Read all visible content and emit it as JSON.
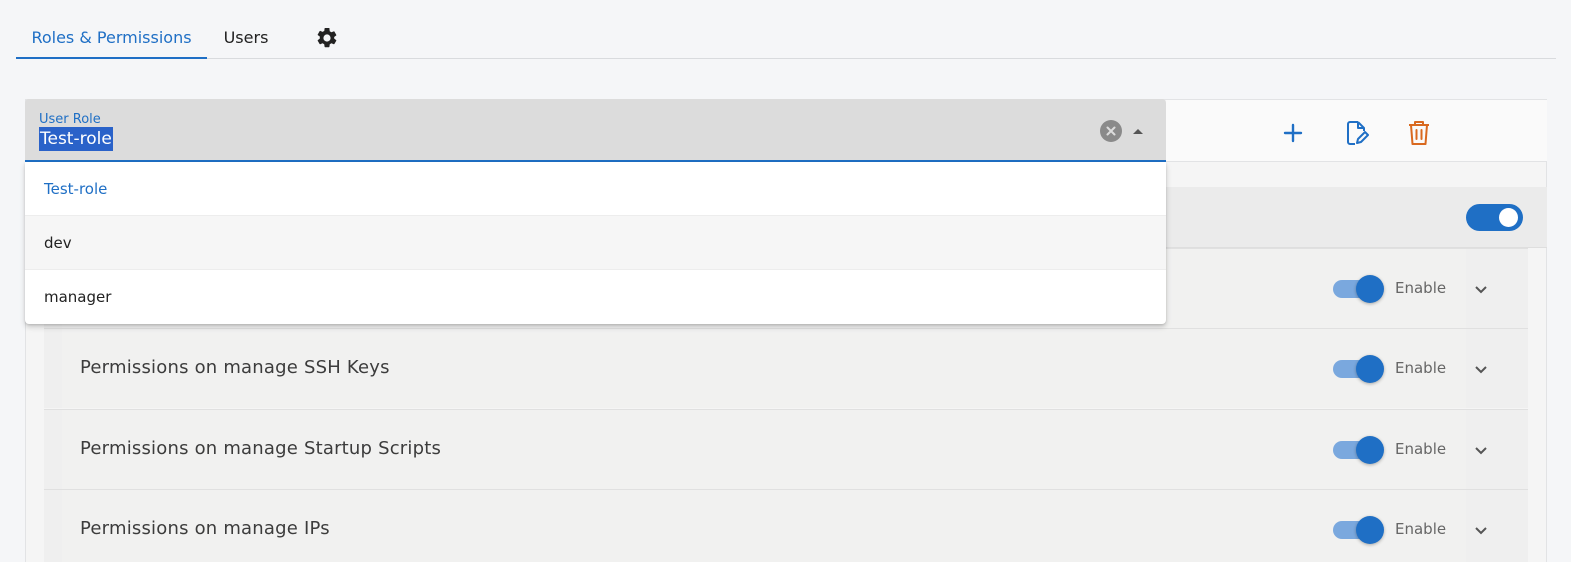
{
  "tabs": [
    {
      "label": "Roles & Permissions",
      "active": true
    },
    {
      "label": "Users",
      "active": false
    }
  ],
  "settings_icon": "gear-icon",
  "role_select": {
    "label": "User Role",
    "value": "Test-role",
    "options": [
      "Test-role",
      "dev",
      "manager"
    ]
  },
  "toolbar": {
    "add_icon": "plus-icon",
    "edit_icon": "edit-document-icon",
    "delete_icon": "trash-icon"
  },
  "master_toggle": {
    "enabled": true
  },
  "permissions": [
    {
      "title": "",
      "enable_label": "Enable",
      "enabled": true
    },
    {
      "title": "Permissions on manage SSH Keys",
      "enable_label": "Enable",
      "enabled": true
    },
    {
      "title": "Permissions on manage Startup Scripts",
      "enable_label": "Enable",
      "enabled": true
    },
    {
      "title": "Permissions on manage IPs",
      "enable_label": "Enable",
      "enabled": true
    }
  ],
  "colors": {
    "accent": "#1f6fc5",
    "delete": "#d9691f"
  }
}
